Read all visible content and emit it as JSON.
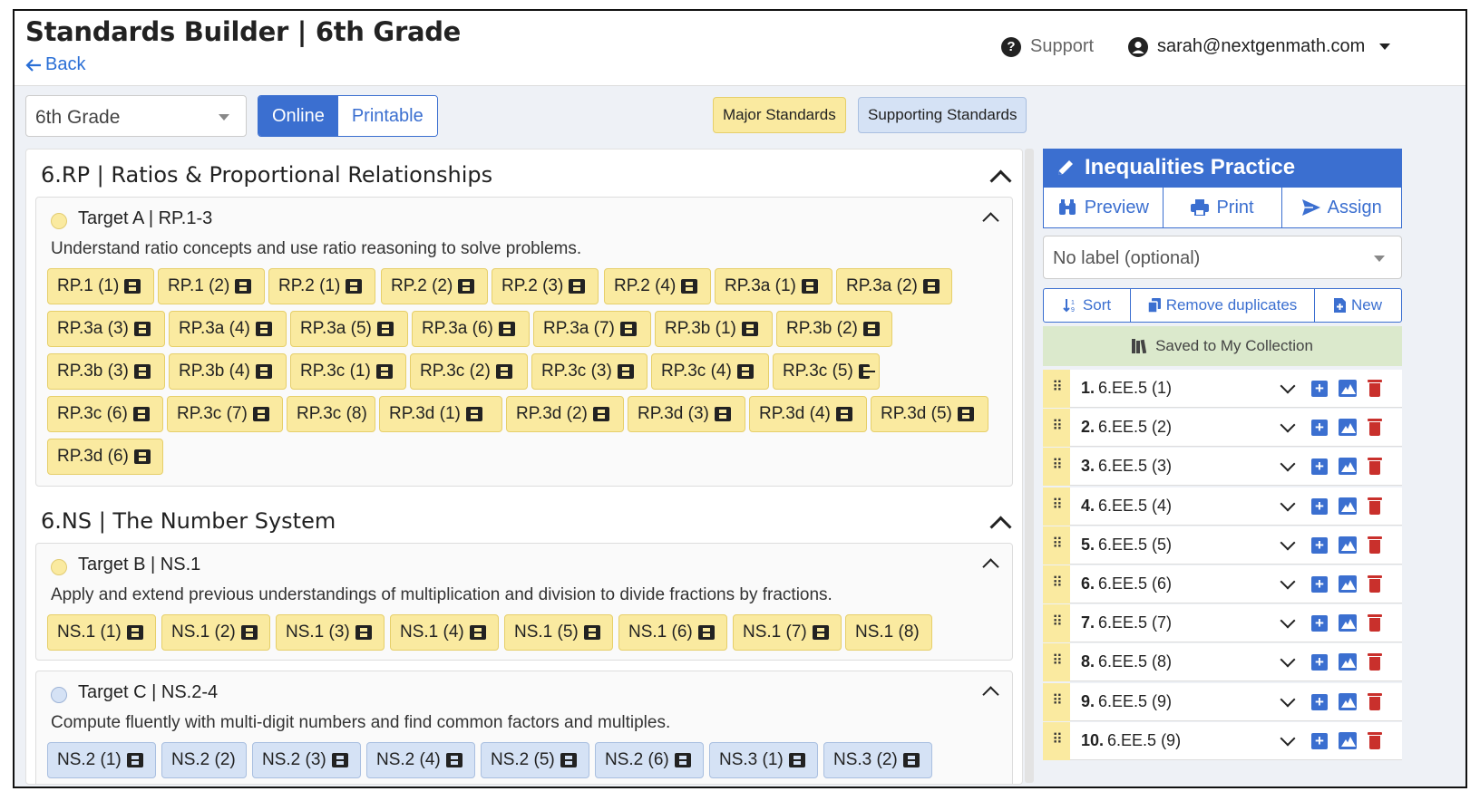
{
  "header": {
    "title": "Standards Builder | 6th Grade",
    "back_label": "Back",
    "support_label": "Support",
    "user_email": "sarah@nextgenmath.com"
  },
  "toolbar": {
    "grade_value": "6th Grade",
    "view_options": [
      "Online",
      "Printable"
    ],
    "view_selected": "Online",
    "major_label": "Major Standards",
    "supporting_label": "Supporting Standards"
  },
  "colors": {
    "primary": "#3b6fd0",
    "major": "#faeaa0",
    "supporting": "#d5e2f5",
    "saved_bg": "#dbe9cc",
    "danger": "#c9302c"
  },
  "domains": [
    {
      "title": "6.RP | Ratios & Proportional Relationships",
      "targets": [
        {
          "title": "Target A | RP.1-3",
          "type": "major",
          "description": "Understand ratio concepts and use ratio reasoning to solve problems.",
          "chips": [
            {
              "label": "RP.1 (1)",
              "video": true
            },
            {
              "label": "RP.1 (2)",
              "video": true
            },
            {
              "label": "RP.2 (1)",
              "video": true
            },
            {
              "label": "RP.2 (2)",
              "video": true
            },
            {
              "label": "RP.2 (3)",
              "video": true
            },
            {
              "label": "RP.2 (4)",
              "video": true
            },
            {
              "label": "RP.3a (1)",
              "video": true
            },
            {
              "label": "RP.3a (2)",
              "video": true
            },
            {
              "label": "RP.3a (3)",
              "video": true
            },
            {
              "label": "RP.3a (4)",
              "video": true
            },
            {
              "label": "RP.3a (5)",
              "video": true
            },
            {
              "label": "RP.3a (6)",
              "video": true
            },
            {
              "label": "RP.3a (7)",
              "video": true
            },
            {
              "label": "RP.3b (1)",
              "video": true
            },
            {
              "label": "RP.3b (2)",
              "video": true
            },
            {
              "label": "RP.3b (3)",
              "video": true
            },
            {
              "label": "RP.3b (4)",
              "video": true
            },
            {
              "label": "RP.3c (1)",
              "video": true
            },
            {
              "label": "RP.3c (2)",
              "video": true
            },
            {
              "label": "RP.3c (3)",
              "video": true
            },
            {
              "label": "RP.3c (4)",
              "video": true
            },
            {
              "label": "RP.3c (5)",
              "video": true
            },
            {
              "label": "RP.3c (6)",
              "video": true
            },
            {
              "label": "RP.3c (7)",
              "video": true
            },
            {
              "label": "RP.3c (8)",
              "video": false
            },
            {
              "label": "RP.3d (1)",
              "video": true
            },
            {
              "label": "RP.3d (2)",
              "video": true
            },
            {
              "label": "RP.3d (3)",
              "video": true
            },
            {
              "label": "RP.3d (4)",
              "video": true
            },
            {
              "label": "RP.3d (5)",
              "video": true
            },
            {
              "label": "RP.3d (6)",
              "video": true
            }
          ]
        }
      ]
    },
    {
      "title": "6.NS | The Number System",
      "targets": [
        {
          "title": "Target B | NS.1",
          "type": "major",
          "description": "Apply and extend previous understandings of multiplication and division to divide fractions by fractions.",
          "chips": [
            {
              "label": "NS.1 (1)",
              "video": true
            },
            {
              "label": "NS.1 (2)",
              "video": true
            },
            {
              "label": "NS.1 (3)",
              "video": true
            },
            {
              "label": "NS.1 (4)",
              "video": true
            },
            {
              "label": "NS.1 (5)",
              "video": true
            },
            {
              "label": "NS.1 (6)",
              "video": true
            },
            {
              "label": "NS.1 (7)",
              "video": true
            },
            {
              "label": "NS.1 (8)",
              "video": false
            }
          ]
        },
        {
          "title": "Target C | NS.2-4",
          "type": "supporting",
          "description": "Compute fluently with multi-digit numbers and find common factors and multiples.",
          "chips": [
            {
              "label": "NS.2 (1)",
              "video": true
            },
            {
              "label": "NS.2 (2)",
              "video": false
            },
            {
              "label": "NS.2 (3)",
              "video": true
            },
            {
              "label": "NS.2 (4)",
              "video": true
            },
            {
              "label": "NS.2 (5)",
              "video": true
            },
            {
              "label": "NS.2 (6)",
              "video": true
            },
            {
              "label": "NS.3 (1)",
              "video": true
            },
            {
              "label": "NS.3 (2)",
              "video": true
            }
          ]
        }
      ]
    }
  ],
  "assignment": {
    "title": "Inequalities Practice",
    "actions": [
      "Preview",
      "Print",
      "Assign"
    ],
    "label_placeholder": "No label (optional)",
    "tools": [
      "Sort",
      "Remove duplicates",
      "New"
    ],
    "saved_message": "Saved to My Collection",
    "items": [
      {
        "num": "1.",
        "label": "6.EE.5 (1)"
      },
      {
        "num": "2.",
        "label": "6.EE.5 (2)"
      },
      {
        "num": "3.",
        "label": "6.EE.5 (3)"
      },
      {
        "num": "4.",
        "label": "6.EE.5 (4)"
      },
      {
        "num": "5.",
        "label": "6.EE.5 (5)"
      },
      {
        "num": "6.",
        "label": "6.EE.5 (6)"
      },
      {
        "num": "7.",
        "label": "6.EE.5 (7)"
      },
      {
        "num": "8.",
        "label": "6.EE.5 (8)"
      },
      {
        "num": "9.",
        "label": "6.EE.5 (9)"
      },
      {
        "num": "10.",
        "label": "6.EE.5 (9)"
      }
    ]
  }
}
